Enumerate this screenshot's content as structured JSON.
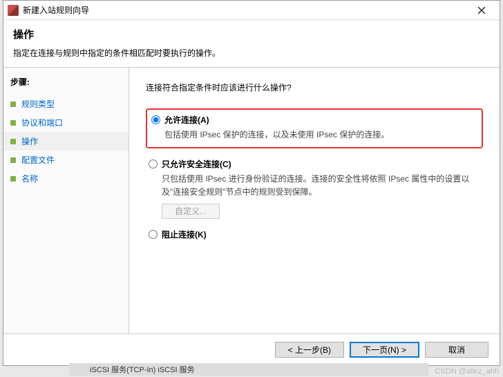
{
  "window": {
    "title": "新建入站规则向导"
  },
  "header": {
    "title": "操作",
    "description": "指定在连接与规则中指定的条件相匹配时要执行的操作。"
  },
  "sidebar": {
    "steps_label": "步骤:",
    "items": [
      {
        "label": "规则类型"
      },
      {
        "label": "协议和端口"
      },
      {
        "label": "操作"
      },
      {
        "label": "配置文件"
      },
      {
        "label": "名称"
      }
    ]
  },
  "main": {
    "question": "连接符合指定条件时应该进行什么操作?",
    "options": [
      {
        "id": "allow",
        "label": "允许连接(A)",
        "desc": "包括使用 IPsec 保护的连接，以及未使用 IPsec 保护的连接。",
        "checked": true
      },
      {
        "id": "secure",
        "label": "只允许安全连接(C)",
        "desc": "只包括使用 IPsec 进行身份验证的连接。连接的安全性将依照 IPsec 属性中的设置以及\"连接安全规则\"节点中的规则受到保障。",
        "checked": false
      },
      {
        "id": "block",
        "label": "阻止连接(K)",
        "checked": false
      }
    ],
    "customize_button": "自定义..."
  },
  "footer": {
    "back": "< 上一步(B)",
    "next": "下一页(N) >",
    "cancel": "取消"
  },
  "background_strip": "iSCSI 服务(TCP-In)          iSCSI 服务",
  "watermark": "CSDN @aliez_ahh"
}
